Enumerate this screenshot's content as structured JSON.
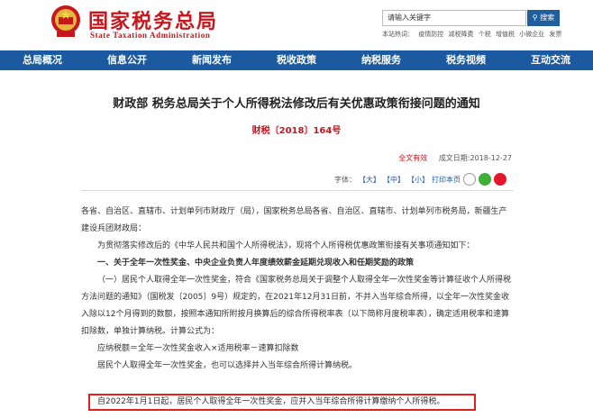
{
  "header": {
    "site_title": "国家税务总局",
    "site_subtitle": "State Taxation Administration",
    "search_value": "请输入关键字",
    "search_button": "搜索",
    "hotwords_label": "本站热词：",
    "hotwords": [
      "疫情防控",
      "减税降费",
      "个税",
      "增值税",
      "小微企业",
      "发票"
    ]
  },
  "nav": {
    "items": [
      "总局概况",
      "信息公开",
      "新闻发布",
      "税收政策",
      "纳税服务",
      "税务视频",
      "互动交流"
    ]
  },
  "article": {
    "title": "财政部 税务总局关于个人所得税法修改后有关优惠政策衔接问题的通知",
    "doc_number": "财税〔2018〕164号",
    "full_text_label": "全文有效",
    "date_label": "成文日期:2018-12-27",
    "font_label": "字体：",
    "font_large": "【大】",
    "font_medium": "【中】",
    "font_small": "【小】",
    "print_label": "打印本页",
    "addressee": "各省、自治区、直辖市、计划单列市财政厅（局），国家税务总局各省、自治区、直辖市、计划单列市税务局，新疆生产建设兵团财政局：",
    "intro": "为贯彻落实修改后的《中华人民共和国个人所得税法》，现将个人所得税优惠政策衔接有关事项通知如下：",
    "section_heading": "一、关于全年一次性奖金、中央企业负责人年度绩效薪金延期兑现收入和任期奖励的政策",
    "paragraph1": "（一）居民个人取得全年一次性奖金，符合《国家税务总局关于调整个人取得全年一次性奖金等计算征收个人所得税方法问题的通知》（国税发〔2005〕9号）规定的，在2021年12月31日前，不并入当年综合所得，以全年一次性奖金收入除以12个月得到的数额，按照本通知所附按月换算后的综合所得税率表（以下简称月度税率表），确定适用税率和速算扣除数，单独计算纳税。计算公式为：",
    "formula": "应纳税额＝全年一次性奖金收入×适用税率－速算扣除数",
    "paragraph2": "居民个人取得全年一次性奖金，也可以选择并入当年综合所得计算纳税。",
    "highlight": "自2022年1月1日起，居民个人取得全年一次性奖金，应并入当年综合所得计算缴纳个人所得税。"
  },
  "colors": {
    "brand_red": "#c8161d",
    "nav_blue": "#1b5aa0",
    "highlight_border": "#e0201b"
  }
}
